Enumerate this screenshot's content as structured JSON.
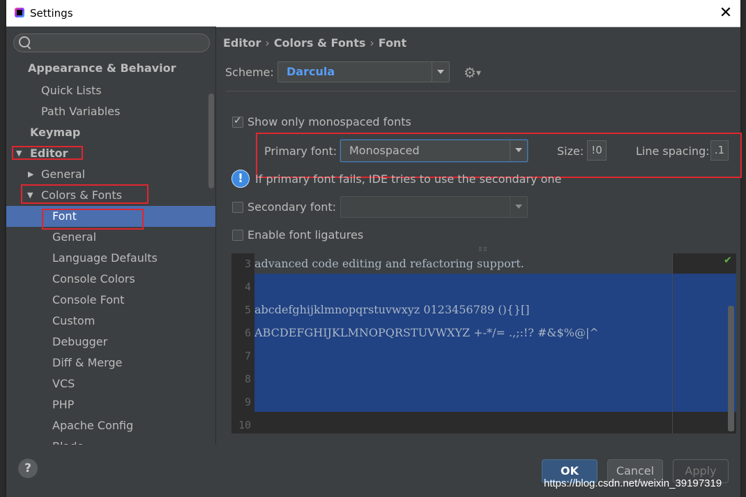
{
  "window": {
    "title": "Settings",
    "close": "✕"
  },
  "sidebar": {
    "search_placeholder": "",
    "items": [
      {
        "label": "Appearance & Behavior"
      },
      {
        "label": "Quick Lists"
      },
      {
        "label": "Path Variables"
      },
      {
        "label": "Keymap"
      },
      {
        "label": "Editor"
      },
      {
        "label": "General"
      },
      {
        "label": "Colors & Fonts"
      },
      {
        "label": "Font"
      },
      {
        "label": "General"
      },
      {
        "label": "Language Defaults"
      },
      {
        "label": "Console Colors"
      },
      {
        "label": "Console Font"
      },
      {
        "label": "Custom"
      },
      {
        "label": "Debugger"
      },
      {
        "label": "Diff & Merge"
      },
      {
        "label": "VCS"
      },
      {
        "label": "PHP"
      },
      {
        "label": "Apache Config"
      },
      {
        "label": "Blade"
      }
    ]
  },
  "breadcrumb": [
    "Editor",
    "Colors & Fonts",
    "Font"
  ],
  "scheme": {
    "label": "Scheme:",
    "value": "Darcula"
  },
  "options": {
    "show_mono": "Show only monospaced fonts",
    "primary_font_label": "Primary font:",
    "primary_font_value": "Monospaced",
    "size_label": "Size:",
    "size_value": "!0",
    "line_spacing_label": "Line spacing:",
    "line_spacing_value": ".1",
    "info_text": "If primary font fails, IDE tries to use the secondary one",
    "secondary_label": "Secondary font:",
    "ligatures_label": "Enable font ligatures"
  },
  "preview": {
    "lines": [
      {
        "num": "3",
        "text": "advanced code editing and refactoring support."
      },
      {
        "num": "4",
        "text": ""
      },
      {
        "num": "5",
        "text": "abcdefghijklmnopqrstuvwxyz 0123456789 (){}[]"
      },
      {
        "num": "6",
        "text": "ABCDEFGHIJKLMNOPQRSTUVWXYZ +-*/= .,;:!? #&$%@|^"
      },
      {
        "num": "7",
        "text": ""
      },
      {
        "num": "8",
        "text": ""
      },
      {
        "num": "9",
        "text": ""
      },
      {
        "num": "10",
        "text": ""
      }
    ]
  },
  "footer": {
    "help": "?",
    "ok": "OK",
    "cancel": "Cancel",
    "apply": "Apply"
  },
  "watermark": "https://blog.csdn.net/weixin_39197319",
  "colors": {
    "selection": "#4b6eaf",
    "highlight_box": "#e0262f",
    "preview_selection": "#214283",
    "scheme_text": "#589df6"
  },
  "icons": [
    "search-icon",
    "gear-icon",
    "info-icon",
    "help-icon",
    "close-icon",
    "chevron-down-icon",
    "check-icon"
  ]
}
